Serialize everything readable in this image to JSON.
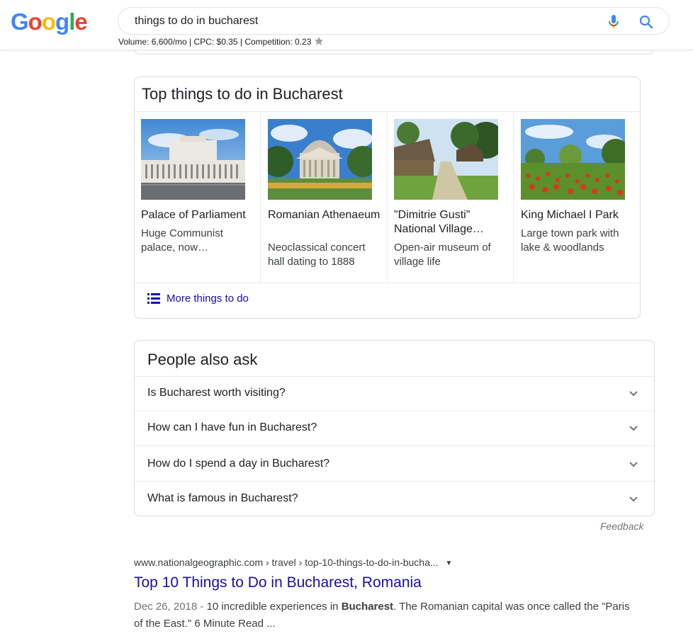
{
  "logo": {
    "letters": [
      "G",
      "o",
      "o",
      "g",
      "l",
      "e"
    ],
    "colors": [
      "#4285F4",
      "#EA4335",
      "#FBBC05",
      "#4285F4",
      "#34A853",
      "#EA4335"
    ]
  },
  "search": {
    "query": "things to do in bucharest"
  },
  "keyword_stats": "Volume: 6,600/mo | CPC: $0.35 | Competition: 0.23",
  "things": {
    "title": "Top things to do in Bucharest",
    "items": [
      {
        "name": "Palace of Parliament",
        "desc": "Huge Communist palace, now…"
      },
      {
        "name": "Romanian Athenaeum",
        "desc": "Neoclassical concert hall dating to 1888"
      },
      {
        "name": "\"Dimitrie Gusti\" National Village…",
        "desc": "Open-air museum of village life"
      },
      {
        "name": "King Michael I Park",
        "desc": "Large town park with lake & woodlands"
      }
    ],
    "more_label": "More things to do"
  },
  "paa": {
    "title": "People also ask",
    "questions": [
      "Is Bucharest worth visiting?",
      "How can I have fun in Bucharest?",
      "How do I spend a day in Bucharest?",
      "What is famous in Bucharest?"
    ],
    "feedback": "Feedback"
  },
  "result": {
    "cite": "www.nationalgeographic.com › travel › top-10-things-to-do-in-bucha...",
    "title": "Top 10 Things to Do in Bucharest, Romania",
    "date": "Dec 26, 2018 - ",
    "snippet_pre": "10 incredible experiences in ",
    "snippet_bold": "Bucharest",
    "snippet_post": ". The Romanian capital was once called the \"Paris of the East.\" 6 Minute Read ..."
  },
  "colors": {
    "link": "#1a0dab",
    "text": "#202124",
    "muted": "#70757a"
  }
}
